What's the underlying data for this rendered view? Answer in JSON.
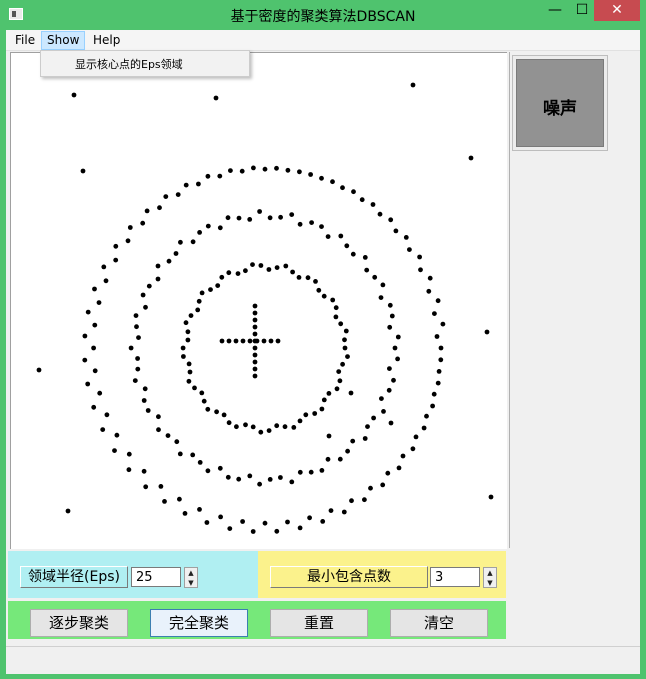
{
  "window": {
    "title": "基于密度的聚类算法DBSCAN",
    "minimize_glyph": "—",
    "maximize_glyph": "☐",
    "close_glyph": "✕"
  },
  "menu": {
    "file": "File",
    "show": "Show",
    "help": "Help",
    "show_items": [
      "显示核心点的Eps领域"
    ]
  },
  "legend": {
    "noise_label": "噪声",
    "noise_color": "#929292"
  },
  "params": {
    "eps_label": "领域半径(Eps)",
    "eps_value": "25",
    "minpts_label": "最小包含点数",
    "minpts_value": "3"
  },
  "buttons": {
    "step_cluster": "逐步聚类",
    "full_cluster": "完全聚类",
    "reset": "重置",
    "clear": "清空"
  },
  "colors": {
    "titlebar": "#4fc36e",
    "eps_panel": "#b0eff2",
    "minpts_panel": "#fbf28c",
    "button_bar": "#76e87a",
    "point": "#000000"
  }
}
